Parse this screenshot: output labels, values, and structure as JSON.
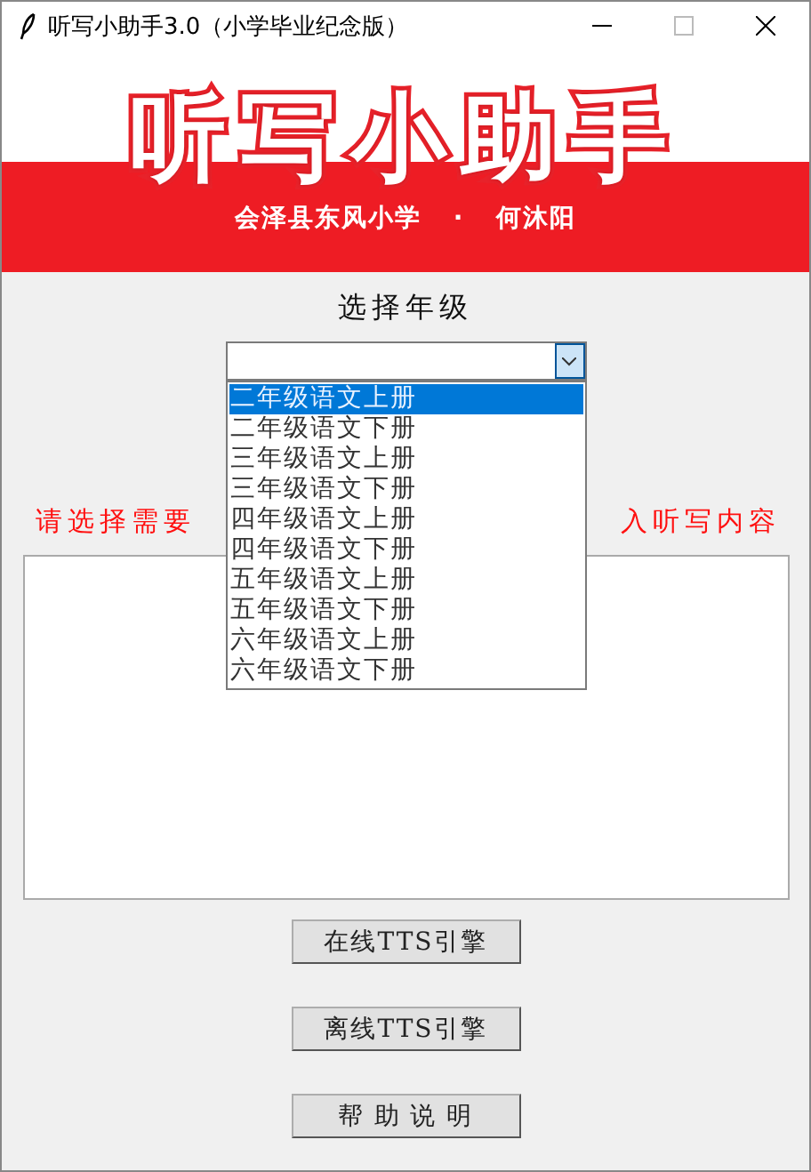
{
  "window": {
    "title": "听写小助手3.0（小学毕业纪念版）"
  },
  "banner": {
    "title": "听写小助手",
    "subtitle": "会泽县东风小学 · 何沐阳"
  },
  "grade": {
    "label": "选择年级",
    "expanded": true,
    "options": [
      {
        "label": "二年级语文上册",
        "selected": true
      },
      {
        "label": "二年级语文下册",
        "selected": false
      },
      {
        "label": "三年级语文上册",
        "selected": false
      },
      {
        "label": "三年级语文下册",
        "selected": false
      },
      {
        "label": "四年级语文上册",
        "selected": false
      },
      {
        "label": "四年级语文下册",
        "selected": false
      },
      {
        "label": "五年级语文上册",
        "selected": false
      },
      {
        "label": "五年级语文下册",
        "selected": false
      },
      {
        "label": "六年级语文上册",
        "selected": false
      },
      {
        "label": "六年级语文下册",
        "selected": false
      }
    ]
  },
  "instruction": {
    "left": "请选择需要",
    "right": "入听写内容"
  },
  "buttons": [
    "在线TTS引擎",
    "离线TTS引擎",
    "帮 助 说 明"
  ]
}
